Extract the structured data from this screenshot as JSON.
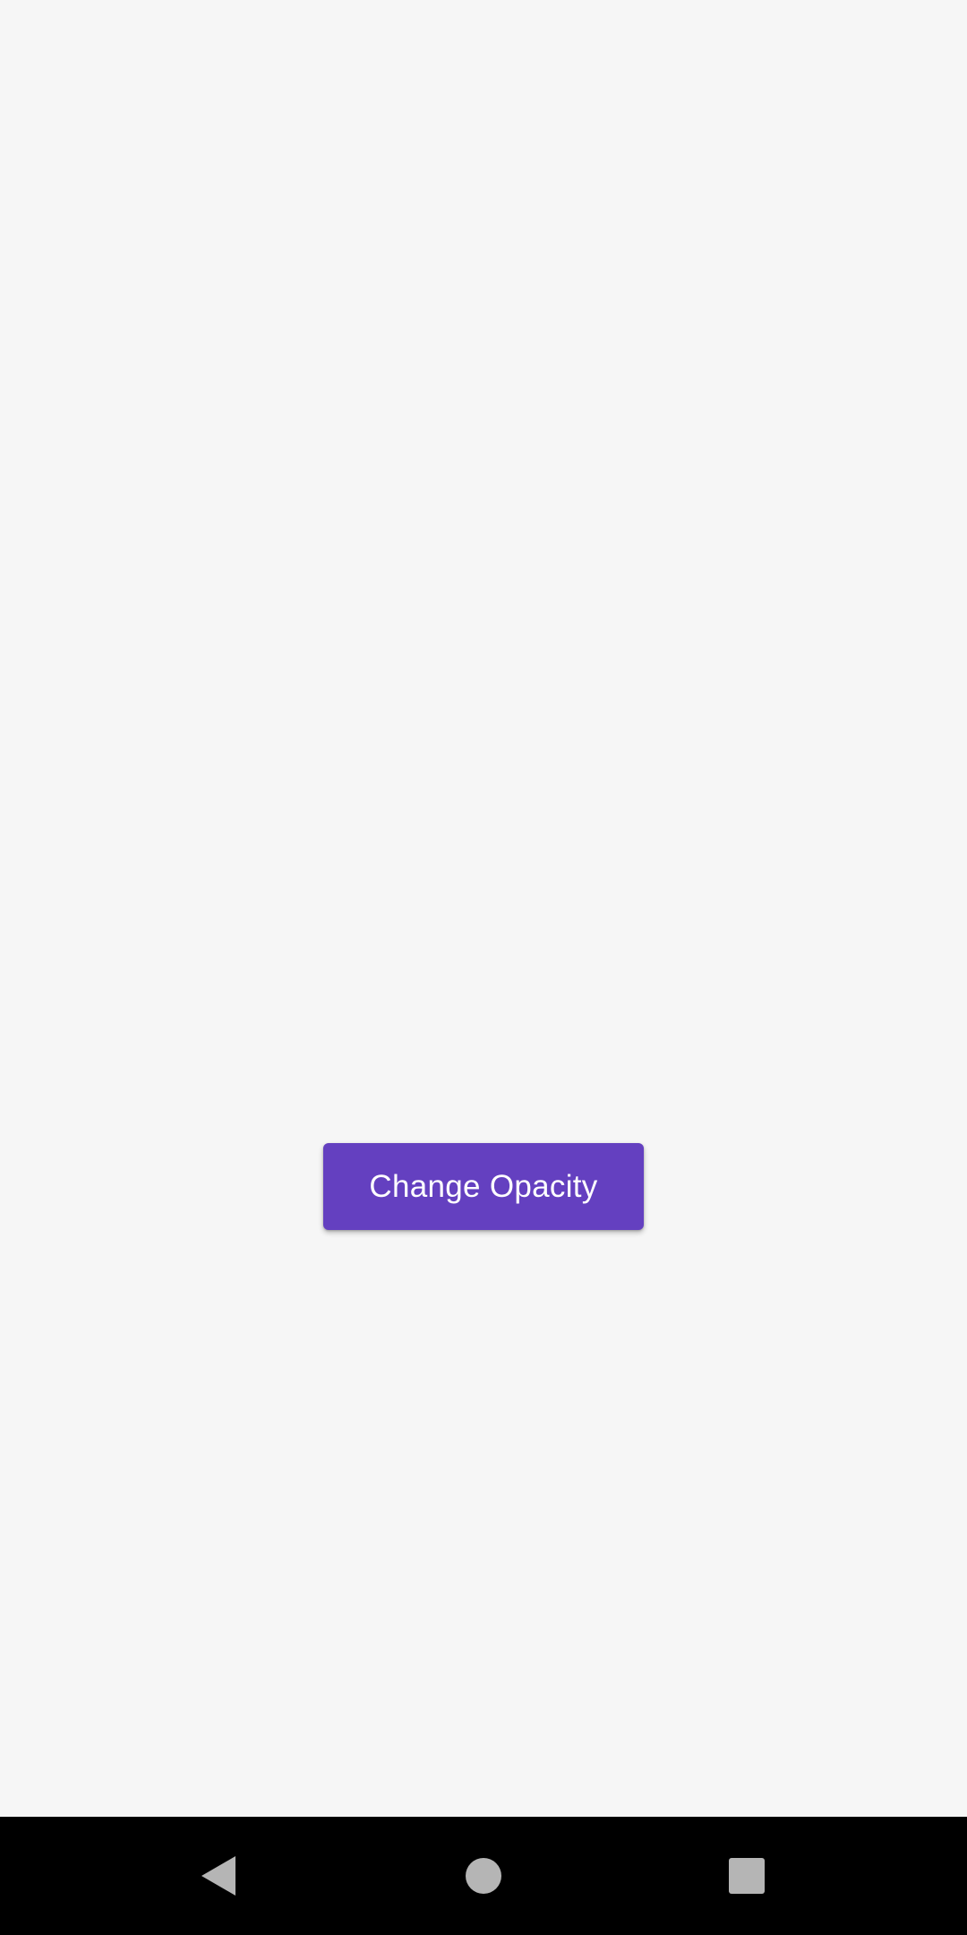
{
  "main": {
    "button_label": "Change Opacity"
  },
  "colors": {
    "background": "#f6f6f6",
    "button": "#6440c0",
    "button_text": "#ffffff",
    "nav_bar": "#000000",
    "nav_icon": "#b5b5b5"
  },
  "nav_bar": {
    "icons": [
      "back-icon",
      "home-icon",
      "recents-icon"
    ]
  }
}
